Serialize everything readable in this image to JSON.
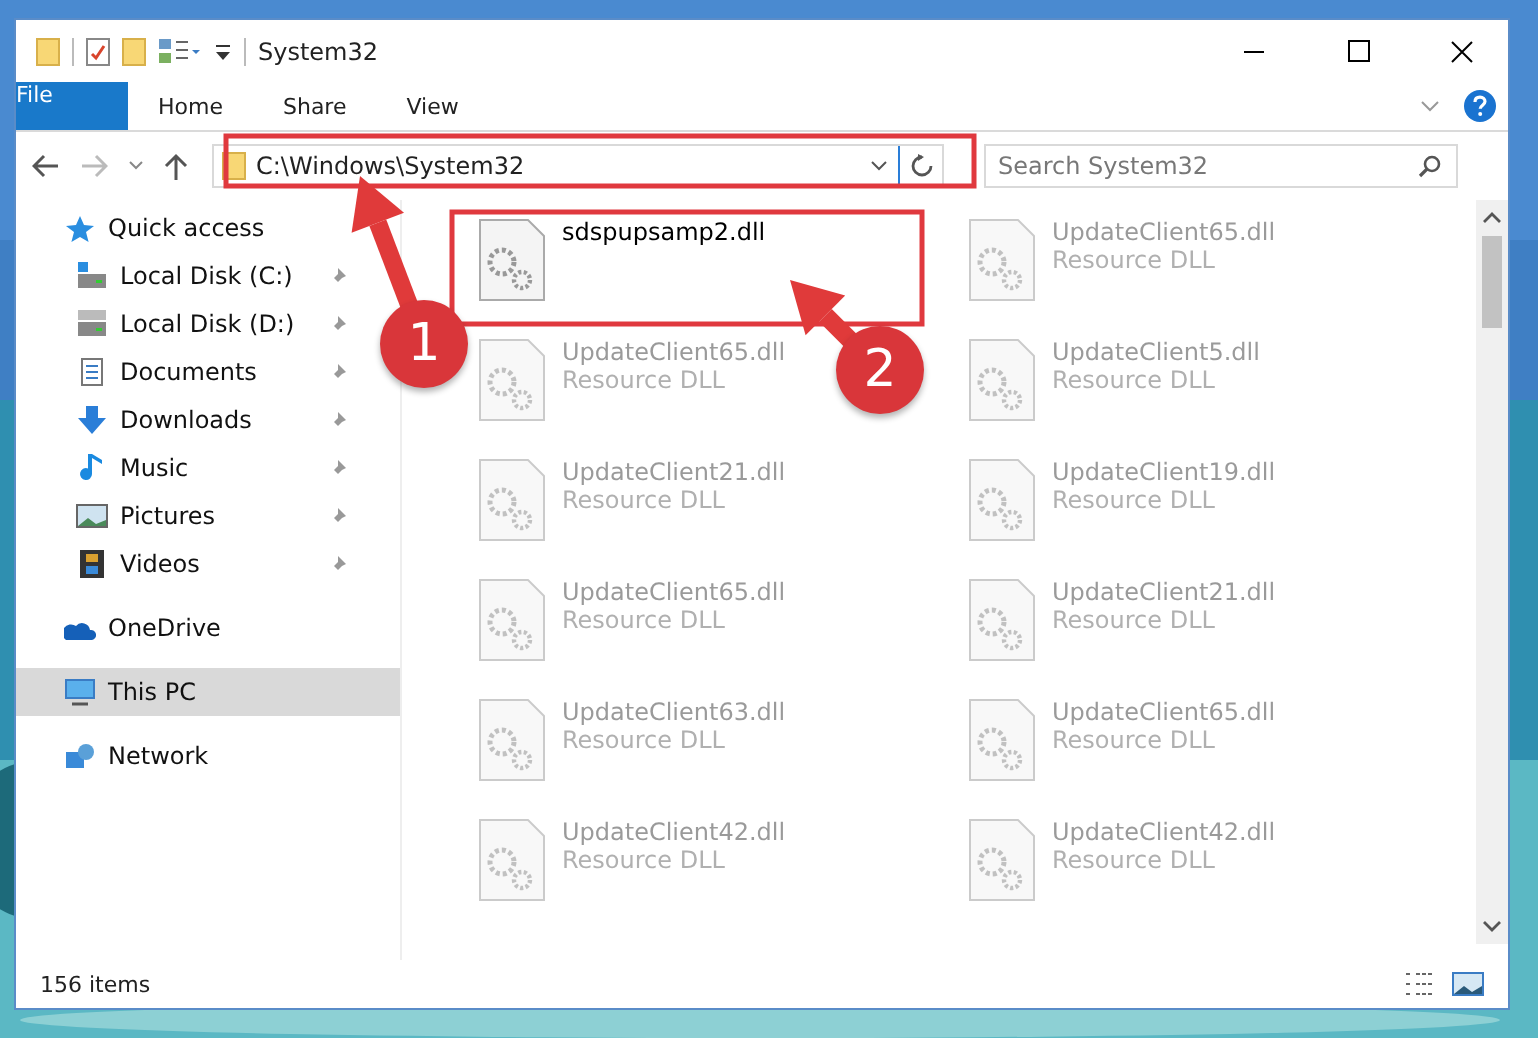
{
  "window": {
    "title": "System32"
  },
  "ribbon_tabs": [
    {
      "label": "File",
      "kind": "file",
      "selected": false
    },
    {
      "label": "Home",
      "kind": "tab",
      "selected": false
    },
    {
      "label": "Share",
      "kind": "tab",
      "selected": false
    },
    {
      "label": "View",
      "kind": "tab",
      "selected": false
    }
  ],
  "address_bar": {
    "path": "C:\\Windows\\System32",
    "highlighted": true
  },
  "search": {
    "placeholder": "Search System32"
  },
  "sidebar": {
    "items": [
      {
        "label": "Quick access",
        "selected": false,
        "children": [
          {
            "label": "Local Disk (C:)",
            "pinned": true,
            "selected": false
          },
          {
            "label": "Local Disk (D:)",
            "pinned": true,
            "selected": false
          },
          {
            "label": "Documents",
            "pinned": true,
            "selected": false
          },
          {
            "label": "Downloads",
            "pinned": true,
            "selected": false
          },
          {
            "label": "Music",
            "pinned": true,
            "selected": false
          },
          {
            "label": "Pictures",
            "pinned": true,
            "selected": false
          },
          {
            "label": "Videos",
            "pinned": true,
            "selected": false
          }
        ]
      },
      {
        "label": "OneDrive",
        "selected": false
      },
      {
        "label": "This PC",
        "selected": true
      },
      {
        "label": "Network",
        "selected": false
      }
    ]
  },
  "files": [
    {
      "name": "sdspupsamp2.dll",
      "faded": false,
      "highlighted": true
    },
    {
      "name": "UpdateClient65.dll",
      "type": "Resource DLL",
      "faded": true,
      "highlighted": false
    },
    {
      "name": "UpdateClient65.dll",
      "type": "Resource DLL",
      "faded": true,
      "highlighted": false
    },
    {
      "name": "UpdateClient5.dll",
      "type": "Resource DLL",
      "faded": true,
      "highlighted": false
    },
    {
      "name": "UpdateClient21.dll",
      "type": "Resource DLL",
      "faded": true,
      "highlighted": false
    },
    {
      "name": "UpdateClient19.dll",
      "type": "Resource DLL",
      "faded": true,
      "highlighted": false
    },
    {
      "name": "UpdateClient65.dll",
      "type": "Resource DLL",
      "faded": true,
      "highlighted": false
    },
    {
      "name": "UpdateClient21.dll",
      "type": "Resource DLL",
      "faded": true,
      "highlighted": false
    },
    {
      "name": "UpdateClient63.dll",
      "type": "Resource DLL",
      "faded": true,
      "highlighted": false
    },
    {
      "name": "UpdateClient65.dll",
      "type": "Resource DLL",
      "faded": true,
      "highlighted": false
    },
    {
      "name": "UpdateClient42.dll",
      "type": "Resource DLL",
      "faded": true,
      "highlighted": false
    },
    {
      "name": "UpdateClient42.dll",
      "type": "Resource DLL",
      "faded": true,
      "highlighted": false
    }
  ],
  "status_bar": {
    "item_count": "156 items"
  },
  "annotations": [
    {
      "label": "1"
    },
    {
      "label": "2"
    }
  ]
}
